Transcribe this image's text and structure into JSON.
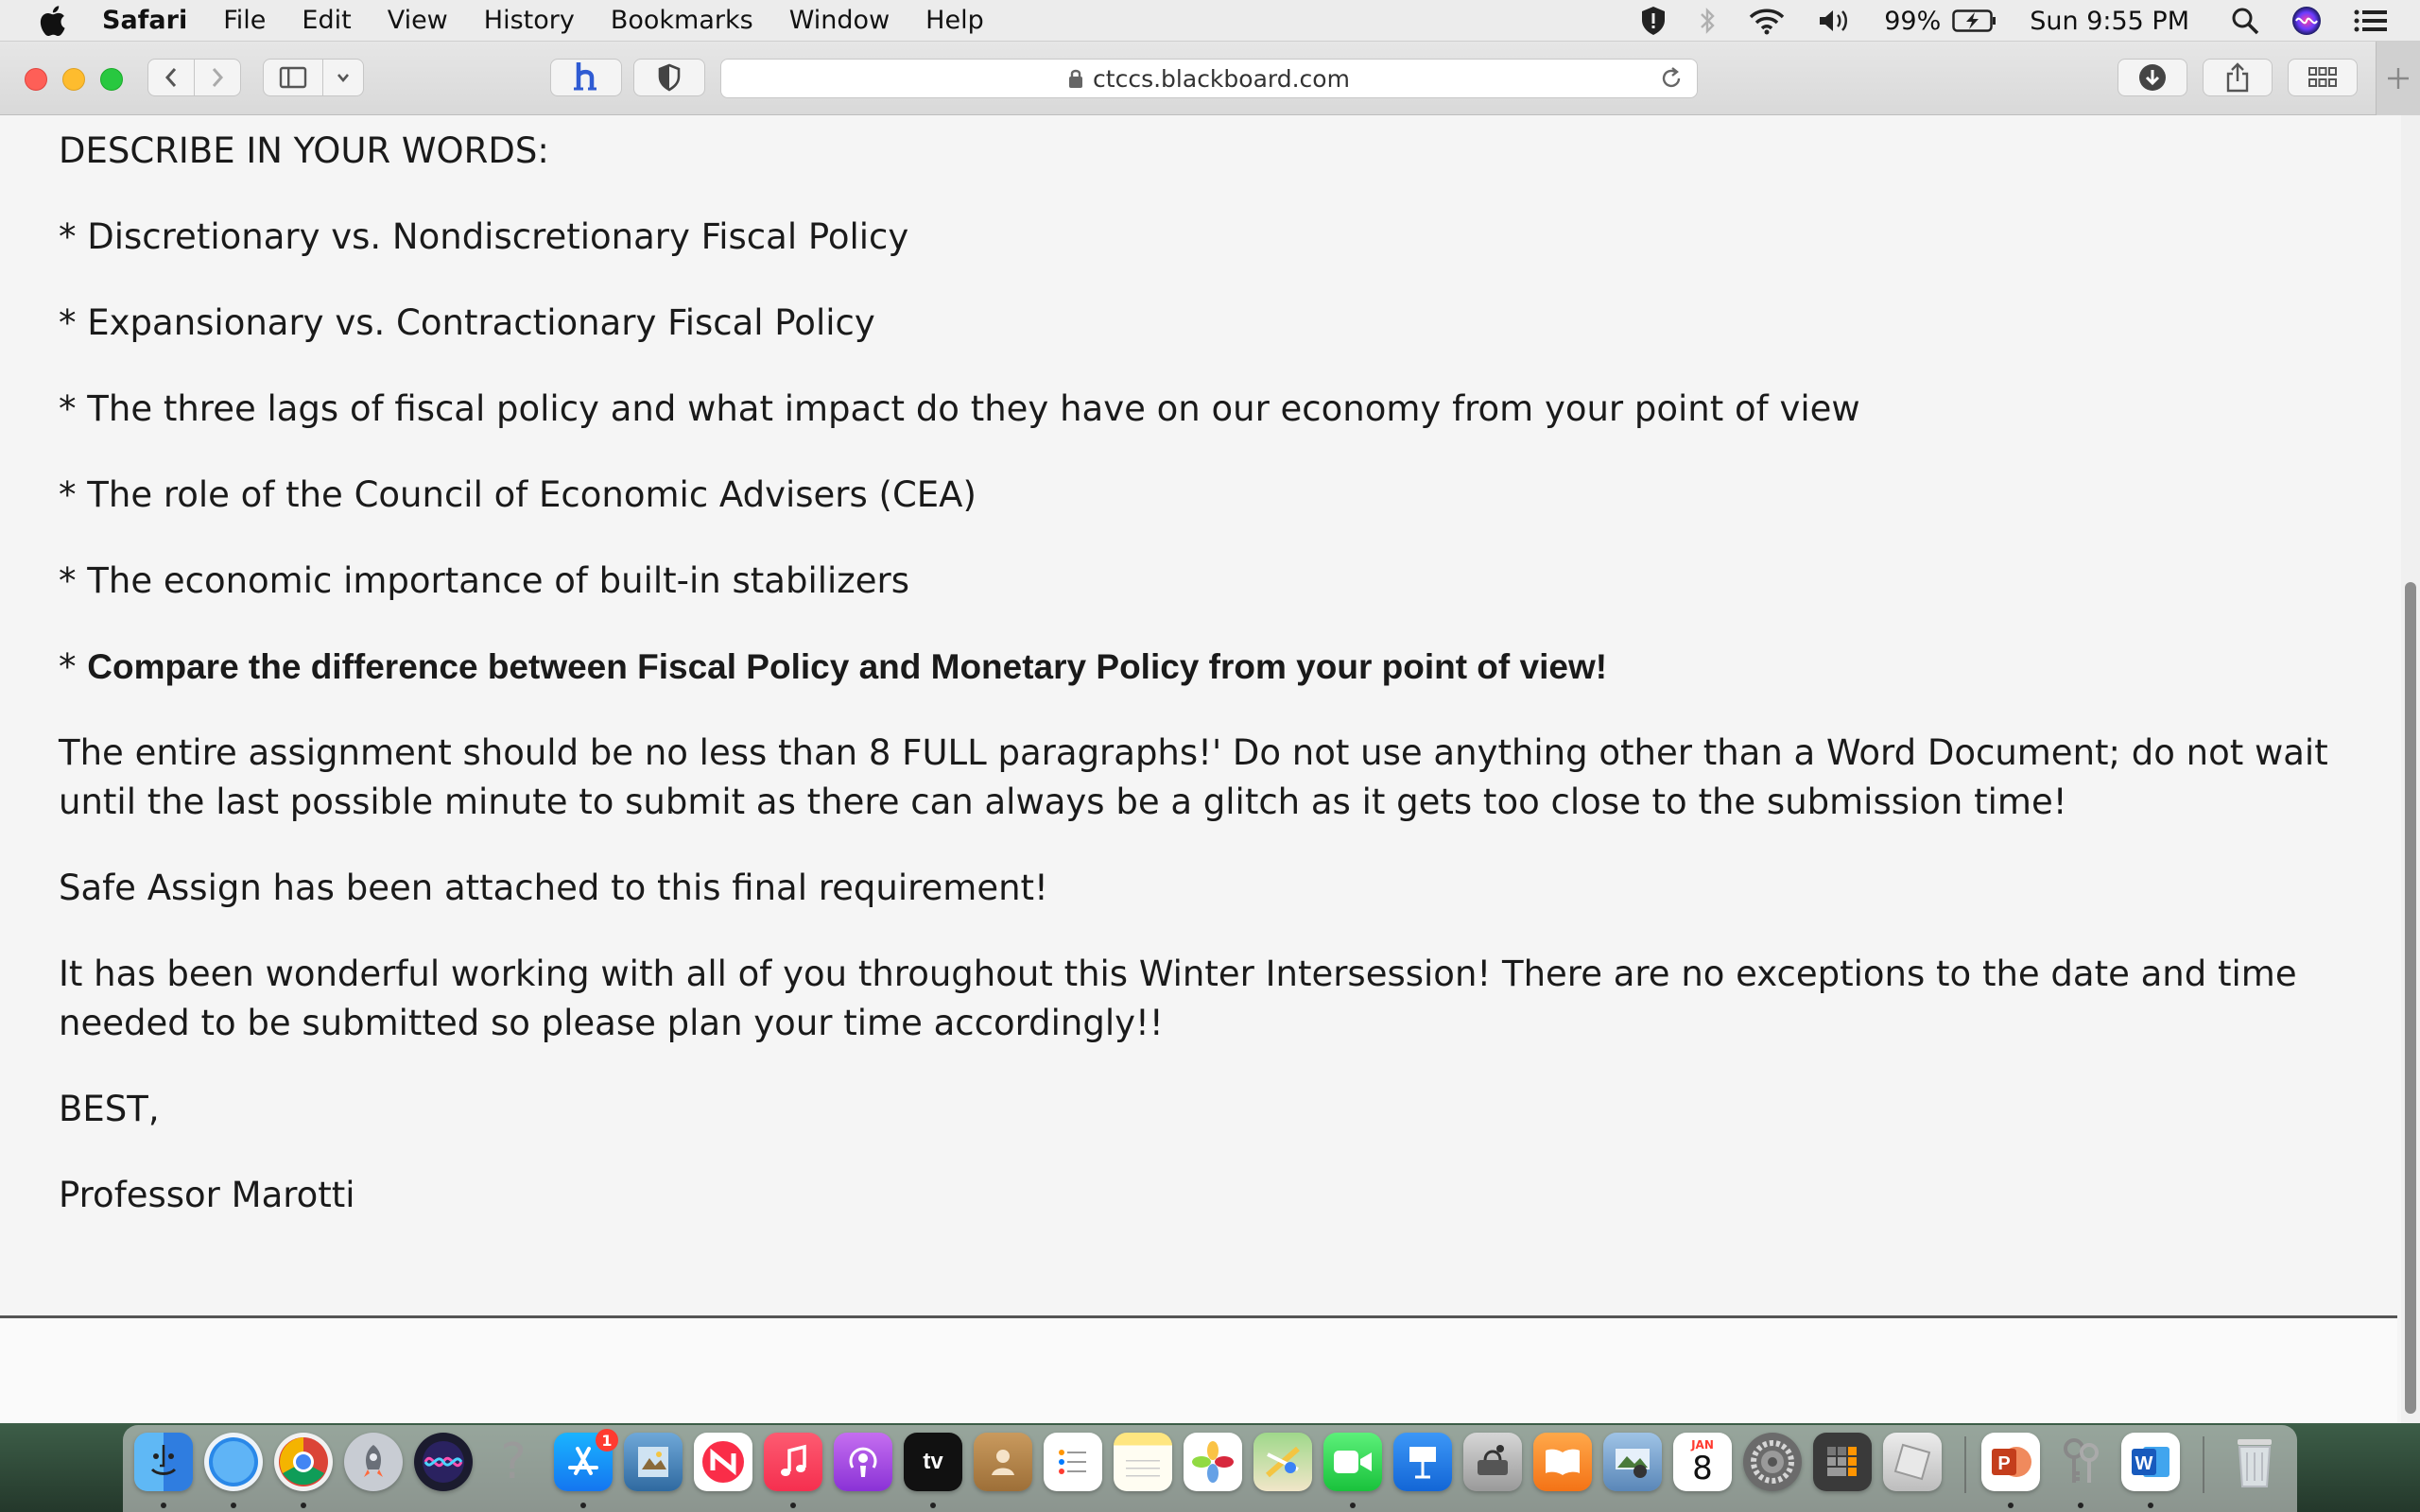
{
  "menubar": {
    "app_name": "Safari",
    "items": [
      "File",
      "Edit",
      "View",
      "History",
      "Bookmarks",
      "Window",
      "Help"
    ],
    "battery": "99%",
    "clock": "Sun 9:55 PM",
    "status_icons": [
      "shield-icon",
      "bluetooth-icon",
      "wifi-icon",
      "volume-icon",
      "battery-icon",
      "spotlight-icon",
      "siri-icon",
      "control-center-icon"
    ]
  },
  "browser": {
    "url": "ctccs.blackboard.com"
  },
  "content": {
    "heading": "DESCRIBE IN YOUR WORDS:",
    "bullets": [
      "* Discretionary vs. Nondiscretionary Fiscal Policy",
      "* Expansionary vs. Contractionary Fiscal Policy",
      "* The three lags of fiscal policy and what impact do they have on our economy from your point of view",
      "* The role of the Council of Economic Advisers (CEA)",
      "* The economic importance of built-in stabilizers"
    ],
    "bold_bullet_prefix": "* ",
    "bold_bullet": "Compare the difference between Fiscal Policy and Monetary Policy from your point of view!",
    "paragraphs": [
      "The entire assignment should be no less than 8 FULL paragraphs!' Do not use anything other than a Word Document; do not wait until the last possible minute to submit as there can always be a glitch as it gets too close to the submission time!",
      "Safe Assign has been attached to this final requirement!",
      "It has been wonderful working with all of you throughout this Winter Intersession! There are no exceptions to the date and time needed to be submitted so please plan your time accordingly!!"
    ],
    "closing": "BEST,",
    "signature": "Professor Marotti"
  },
  "dock": {
    "app_store_badge": "1",
    "calendar_month": "JAN",
    "calendar_day": "8",
    "apps": [
      "finder",
      "safari",
      "chrome",
      "launchpad",
      "siri",
      "help",
      "app-store",
      "preview",
      "news",
      "music",
      "podcasts",
      "tv",
      "contacts",
      "reminders",
      "notes",
      "photos",
      "maps",
      "facetime",
      "keynote",
      "system-info",
      "books",
      "image-capture",
      "calendar",
      "system-preferences",
      "calculator",
      "roblox",
      "powerpoint",
      "keychain",
      "word",
      "trash"
    ]
  }
}
